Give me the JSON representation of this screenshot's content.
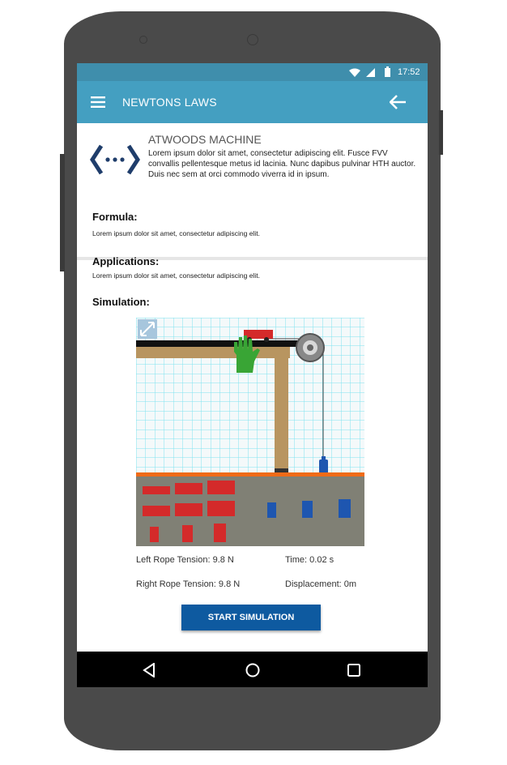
{
  "status": {
    "time": "17:52"
  },
  "appbar": {
    "title": "NEWTONS LAWS",
    "menu_icon": "menu-icon",
    "back_icon": "back-arrow-icon"
  },
  "header": {
    "icon": "code-arrows-icon",
    "title": "ATWOODS MACHINE",
    "description": "Lorem ipsum dolor sit amet, consectetur adipiscing elit. Fusce FVV convallis pellentesque metus id lacinia. Nunc dapibus pulvinar HTH auctor. Duis nec sem at orci commodo viverra id in ipsum."
  },
  "formula": {
    "title": "Formula:",
    "text": "Lorem ipsum dolor sit amet, consectetur adipiscing elit."
  },
  "applications": {
    "title": "Applications:",
    "text": "Lorem ipsum dolor sit amet, consectetur adipiscing elit."
  },
  "simulation": {
    "title": "Simulation:",
    "left_tension": "Left Rope Tension: 9.8 N",
    "right_tension": "Right Rope Tension: 9.8 N",
    "time": "Time: 0.02 s",
    "displacement": "Displacement: 0m",
    "start_label": "START SIMULATION"
  },
  "colors": {
    "appbar": "#449fc1",
    "statusbar": "#3f8eac",
    "button": "#0e5aa0"
  }
}
